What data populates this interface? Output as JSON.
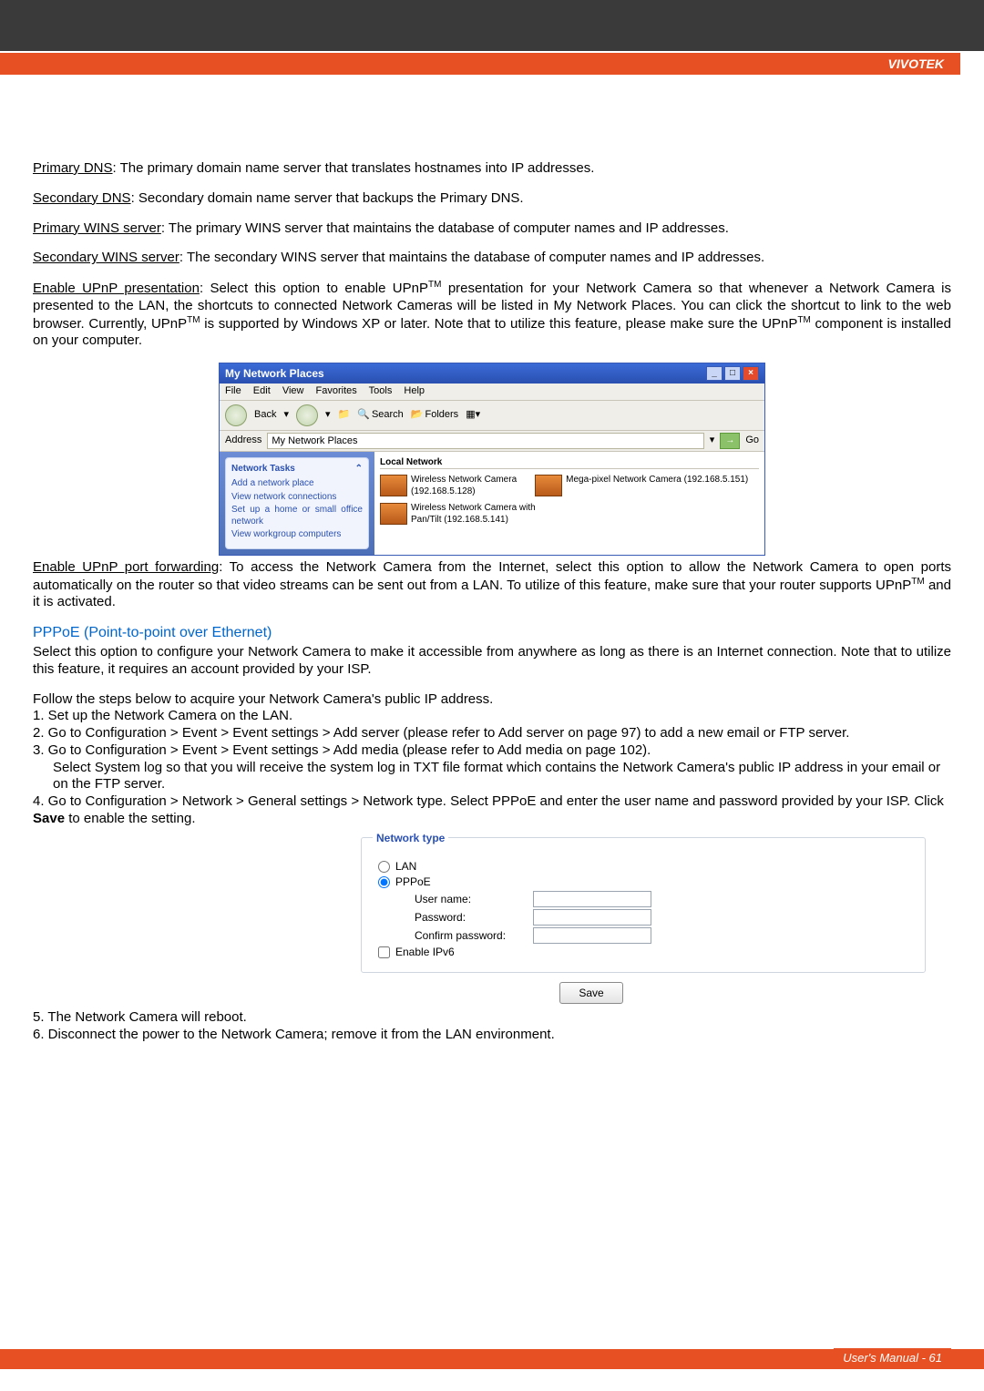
{
  "brand": "VIVOTEK",
  "para": {
    "p1_term": "Primary DNS",
    "p1": ": The primary domain name server that translates hostnames into IP addresses.",
    "p2_term": "Secondary DNS",
    "p2": ": Secondary domain name server that backups the Primary DNS.",
    "p3_term": "Primary WINS server",
    "p3": ": The primary WINS server that maintains the database of computer names and IP addresses.",
    "p4_term": "Secondary WINS server",
    "p4": ": The secondary WINS server that maintains the database of computer names and IP addresses.",
    "p5_term": "Enable UPnP presentation",
    "p5a": ": Select this option to enable UPnP",
    "p5b": " presentation for your Network Camera so that whenever a Network Camera is presented to the LAN, the shortcuts to connected Network Cameras will be listed in My Network Places. You can click the shortcut to link to the web browser. Currently, UPnP",
    "p5c": " is supported by Windows XP or later. Note that to utilize this feature, please make sure the UPnP",
    "p5d": " component is installed on your computer.",
    "tm": "TM",
    "p6_term": "Enable UPnP port forwarding",
    "p6a": ": To access the Network Camera from the Internet, select this option to allow the Network Camera to open ports automatically on the router so that video streams can be sent out from a LAN. To utilize of this feature, make sure that your router supports UPnP",
    "p6b": " and it is activated."
  },
  "screenshot": {
    "title": "My Network Places",
    "menu": [
      "File",
      "Edit",
      "View",
      "Favorites",
      "Tools",
      "Help"
    ],
    "back": "Back",
    "search": "Search",
    "folders": "Folders",
    "addr_label": "Address",
    "addr_value": "My Network Places",
    "go": "Go",
    "tasks_header": "Network Tasks",
    "tasks": [
      "Add a network place",
      "View network connections",
      "Set up a home or small office network",
      "View workgroup computers"
    ],
    "main_header": "Local Network",
    "item1a": "Wireless Network Camera",
    "item1b": "(192.168.5.128)",
    "item2": "Mega-pixel Network Camera (192.168.5.151)",
    "item3a": "Wireless Network Camera with",
    "item3b": "Pan/Tilt (192.168.5.141)"
  },
  "pppoe": {
    "title": "PPPoE (Point-to-point over Ethernet)",
    "intro": "Select this option to configure your Network Camera to make it accessible from anywhere as long as there is an Internet connection. Note that to utilize this feature, it requires an account provided by your ISP.",
    "follow": "Follow the steps below to acquire your Network Camera's public IP address.",
    "s1": "1. Set up the Network Camera on the LAN.",
    "s2": "2. Go to Configuration > Event > Event settings > Add server (please refer to Add server on page 97) to add a new email or FTP server.",
    "s3": "3. Go to Configuration > Event > Event settings > Add media (please refer to Add media on page 102).",
    "s3b": "Select System log so that you will receive the system log in TXT file format which contains the Network Camera's public IP address in your email or on the FTP server.",
    "s4a": "4. Go to Configuration > Network > General settings > Network type. Select PPPoE and enter the user name and password provided by your ISP. Click ",
    "s4_bold": "Save",
    "s4b": " to enable the setting.",
    "s5": "5. The Network Camera will reboot.",
    "s6": "6. Disconnect the power to the Network Camera; remove it from the LAN environment."
  },
  "form": {
    "legend": "Network type",
    "lan": "LAN",
    "pppoe": "PPPoE",
    "user": "User name:",
    "pass": "Password:",
    "confirm": "Confirm password:",
    "ipv6": "Enable IPv6",
    "save": "Save"
  },
  "footer": "User's Manual - 61"
}
